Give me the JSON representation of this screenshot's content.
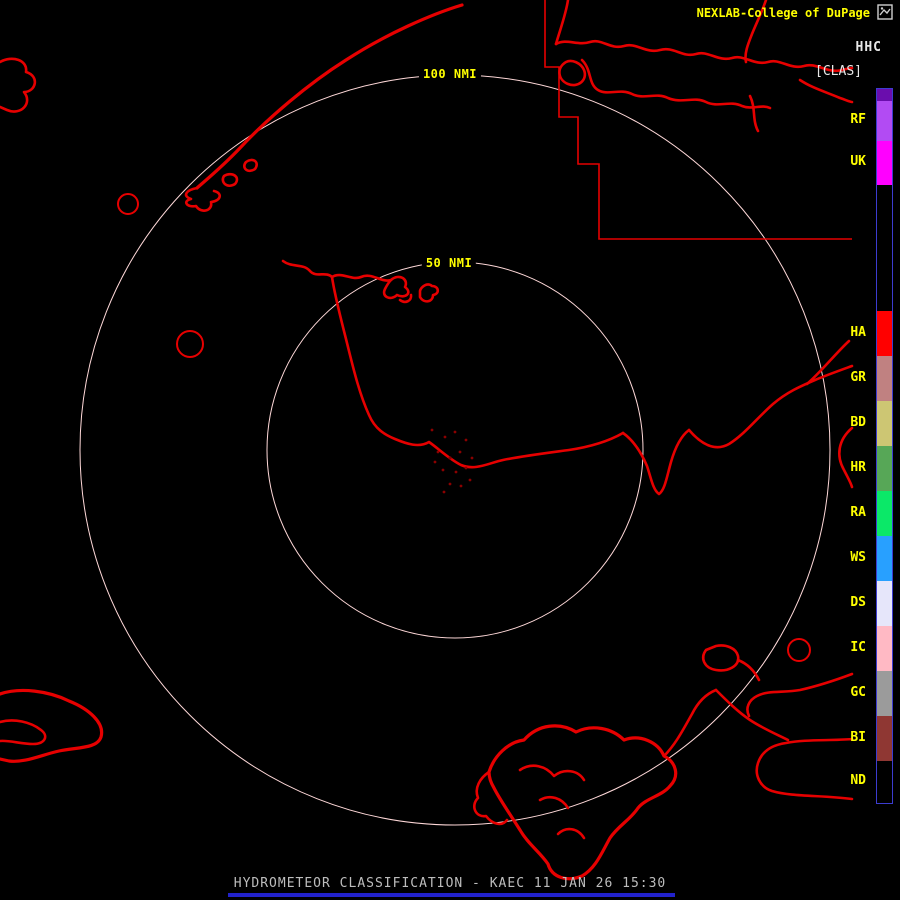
{
  "header": {
    "brand": "NEXLAB-College of DuPage"
  },
  "rings": {
    "outer": {
      "label": "100 NMI"
    },
    "inner": {
      "label": "50 NMI"
    }
  },
  "legend": {
    "product_code": "HHC",
    "mode": "[CLAS]",
    "segments": [
      {
        "label": "",
        "color": "#6a0dad",
        "h": 12
      },
      {
        "label": "RF",
        "color": "#b24bf3",
        "h": 40
      },
      {
        "label": "UK",
        "color": "#ff00ff",
        "h": 44
      },
      {
        "label": "",
        "color": "#000000",
        "h": 126
      },
      {
        "label": "HA",
        "color": "#ff0000",
        "h": 45
      },
      {
        "label": "GR",
        "color": "#c08181",
        "h": 45
      },
      {
        "label": "BD",
        "color": "#cdc673",
        "h": 45
      },
      {
        "label": "HR",
        "color": "#57a757",
        "h": 45
      },
      {
        "label": "RA",
        "color": "#0be868",
        "h": 45
      },
      {
        "label": "WS",
        "color": "#28a0ff",
        "h": 45
      },
      {
        "label": "DS",
        "color": "#e6e6fa",
        "h": 45
      },
      {
        "label": "IC",
        "color": "#ffb9c4",
        "h": 45
      },
      {
        "label": "GC",
        "color": "#9b9b9b",
        "h": 45
      },
      {
        "label": "BI",
        "color": "#8f3733",
        "h": 45
      },
      {
        "label": "ND",
        "color": "#000000",
        "h": 42
      }
    ]
  },
  "footer": {
    "title": "HYDROMETEOR CLASSIFICATION - KAEC 11 JAN 26 15:30"
  },
  "colors": {
    "background": "#000000",
    "map_line": "#e60000",
    "ring_color": "#ffd9d9",
    "label_yellow": "#ffff00",
    "header_white": "#e8e8e8",
    "legend_border": "#3c3cd0",
    "footer_text": "#bdbdbd",
    "footer_bar": "#2222cc",
    "echo_speck": "#8b0000"
  }
}
